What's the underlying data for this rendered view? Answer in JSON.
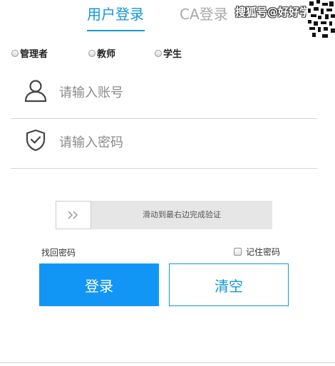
{
  "tabs": {
    "user_login": "用户登录",
    "ca_login": "CA登录"
  },
  "watermark": "搜狐号@好好学",
  "roles": [
    {
      "label": "管理者"
    },
    {
      "label": "教师"
    },
    {
      "label": "学生"
    }
  ],
  "account": {
    "placeholder": "请输入账号",
    "value": "",
    "icon": "user-icon"
  },
  "password": {
    "placeholder": "请输入密码",
    "value": "",
    "icon": "shield-check-icon"
  },
  "slider": {
    "text": "滑动到最右边完成验证",
    "handle_icon": "double-chevron-right-icon"
  },
  "links": {
    "forgot_password": "找回密码",
    "remember_password": "记住密码"
  },
  "buttons": {
    "login": "登录",
    "clear": "清空"
  },
  "colors": {
    "accent": "#1296db",
    "login_button": "#1296f5",
    "inactive_tab": "#a8a8a8",
    "slider_track": "#e6e6e6"
  }
}
